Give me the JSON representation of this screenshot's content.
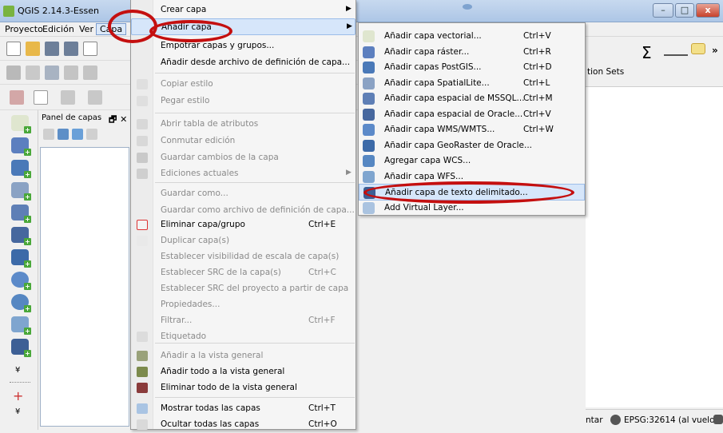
{
  "window": {
    "title": "QGIS 2.14.3-Essen",
    "minimize": "–",
    "maximize": "□",
    "close": "x"
  },
  "menubar": {
    "items": [
      "Proyecto",
      "Edición",
      "Ver",
      "Capa"
    ]
  },
  "layer_panel": {
    "title": "Panel de capas",
    "controls": "🗗 ✕"
  },
  "toolbar": {
    "sigma": "Σ",
    "more": "»",
    "option_sets": "tion Sets"
  },
  "capa_menu": {
    "items": [
      {
        "label": "Crear capa",
        "shortcut": "",
        "submenu": true,
        "disabled": false
      },
      {
        "label": "Añadir capa",
        "shortcut": "",
        "submenu": true,
        "disabled": false
      },
      {
        "label": "Empotrar capas y grupos...",
        "shortcut": "",
        "submenu": false,
        "disabled": false
      },
      {
        "label": "Añadir desde archivo de definición de capa...",
        "shortcut": "",
        "submenu": false,
        "disabled": false
      },
      {
        "label": "Copiar estilo",
        "shortcut": "",
        "submenu": false,
        "disabled": true
      },
      {
        "label": "Pegar estilo",
        "shortcut": "",
        "submenu": false,
        "disabled": true
      },
      {
        "label": "Abrir tabla de atributos",
        "shortcut": "",
        "submenu": false,
        "disabled": true
      },
      {
        "label": "Conmutar edición",
        "shortcut": "",
        "submenu": false,
        "disabled": true
      },
      {
        "label": "Guardar cambios de la capa",
        "shortcut": "",
        "submenu": false,
        "disabled": true
      },
      {
        "label": "Ediciones actuales",
        "shortcut": "",
        "submenu": true,
        "disabled": true
      },
      {
        "label": "Guardar como...",
        "shortcut": "",
        "submenu": false,
        "disabled": true
      },
      {
        "label": "Guardar como archivo de definición de capa...",
        "shortcut": "",
        "submenu": false,
        "disabled": true
      },
      {
        "label": "Eliminar capa/grupo",
        "shortcut": "Ctrl+E",
        "submenu": false,
        "disabled": false
      },
      {
        "label": "Duplicar capa(s)",
        "shortcut": "",
        "submenu": false,
        "disabled": true
      },
      {
        "label": "Establecer visibilidad de escala de capa(s)",
        "shortcut": "",
        "submenu": false,
        "disabled": true
      },
      {
        "label": "Establecer SRC de la capa(s)",
        "shortcut": "Ctrl+C",
        "submenu": false,
        "disabled": true
      },
      {
        "label": "Establecer SRC del proyecto a partir de capa",
        "shortcut": "",
        "submenu": false,
        "disabled": true
      },
      {
        "label": "Propiedades...",
        "shortcut": "",
        "submenu": false,
        "disabled": true
      },
      {
        "label": "Filtrar...",
        "shortcut": "Ctrl+F",
        "submenu": false,
        "disabled": true
      },
      {
        "label": "Etiquetado",
        "shortcut": "",
        "submenu": false,
        "disabled": true
      },
      {
        "label": "Añadir a la vista general",
        "shortcut": "",
        "submenu": false,
        "disabled": true
      },
      {
        "label": "Añadir todo a la vista general",
        "shortcut": "",
        "submenu": false,
        "disabled": false
      },
      {
        "label": "Eliminar todo de la vista general",
        "shortcut": "",
        "submenu": false,
        "disabled": false
      },
      {
        "label": "Mostrar todas las capas",
        "shortcut": "Ctrl+T",
        "submenu": false,
        "disabled": false
      },
      {
        "label": "Ocultar todas las capas",
        "shortcut": "Ctrl+O",
        "submenu": false,
        "disabled": false
      }
    ]
  },
  "anadir_capa_submenu": {
    "items": [
      {
        "label": "Añadir capa vectorial...",
        "shortcut": "Ctrl+V"
      },
      {
        "label": "Añadir capa ráster...",
        "shortcut": "Ctrl+R"
      },
      {
        "label": "Añadir capas PostGIS...",
        "shortcut": "Ctrl+D"
      },
      {
        "label": "Añadir capa SpatialLite...",
        "shortcut": "Ctrl+L"
      },
      {
        "label": "Añadir capa espacial de MSSQL...",
        "shortcut": "Ctrl+M"
      },
      {
        "label": "Añadir capa espacial de Oracle...",
        "shortcut": "Ctrl+V"
      },
      {
        "label": "Añadir capa WMS/WMTS...",
        "shortcut": "Ctrl+W"
      },
      {
        "label": "Añadir capa GeoRaster de Oracle...",
        "shortcut": ""
      },
      {
        "label": "Agregar capa WCS...",
        "shortcut": ""
      },
      {
        "label": "Añadir capa WFS...",
        "shortcut": ""
      },
      {
        "label": "Añadir capa de texto delimitado...",
        "shortcut": ""
      },
      {
        "label": "Add Virtual Layer...",
        "shortcut": ""
      }
    ]
  },
  "statusbar": {
    "partial_text": "ntar",
    "crs": "EPSG:32614 (al vuelo)"
  },
  "colors": {
    "annotation_red": "#c40f0f",
    "highlight": "#d6e6fa",
    "qgis_green": "#79b33f"
  }
}
